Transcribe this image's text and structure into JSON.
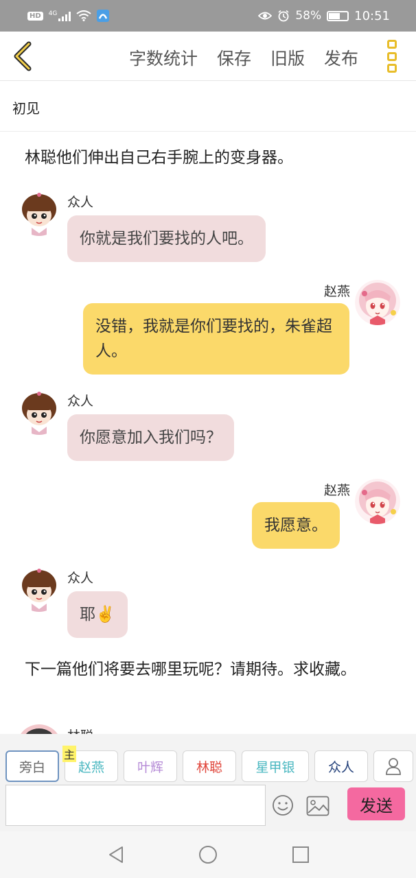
{
  "status_bar": {
    "hd": "HD",
    "network": "4G",
    "battery_pct": "58%",
    "battery_level": 0.58,
    "time": "10:51"
  },
  "toolbar": {
    "actions": [
      "字数统计",
      "保存",
      "旧版",
      "发布"
    ]
  },
  "chapter_title": "初见",
  "messages": [
    {
      "type": "narration",
      "text": "林聪他们伸出自己右手腕上的变身器。"
    },
    {
      "type": "left",
      "name": "众人",
      "text": "你就是我们要找的人吧。"
    },
    {
      "type": "right",
      "name": "赵燕",
      "text": "没错，我就是你们要找的，朱雀超人。"
    },
    {
      "type": "left",
      "name": "众人",
      "text": "你愿意加入我们吗？"
    },
    {
      "type": "right",
      "name": "赵燕",
      "text": "我愿意。"
    },
    {
      "type": "left",
      "name": "众人",
      "text": "耶✌️"
    },
    {
      "type": "narration",
      "text": "下一篇他们将要去哪里玩呢？请期待。求收藏。"
    },
    {
      "type": "left-partial",
      "name": "林聪"
    }
  ],
  "roles": [
    {
      "label": "旁白",
      "color": "#666666"
    },
    {
      "label": "赵燕",
      "color": "#49b7c0",
      "tag": "主"
    },
    {
      "label": "叶辉",
      "color": "#b58ad6"
    },
    {
      "label": "林聪",
      "color": "#e0453a"
    },
    {
      "label": "星甲银",
      "color": "#49b7c0"
    },
    {
      "label": "众人",
      "color": "#23407a"
    }
  ],
  "input": {
    "value": ""
  },
  "send_label": "发送"
}
